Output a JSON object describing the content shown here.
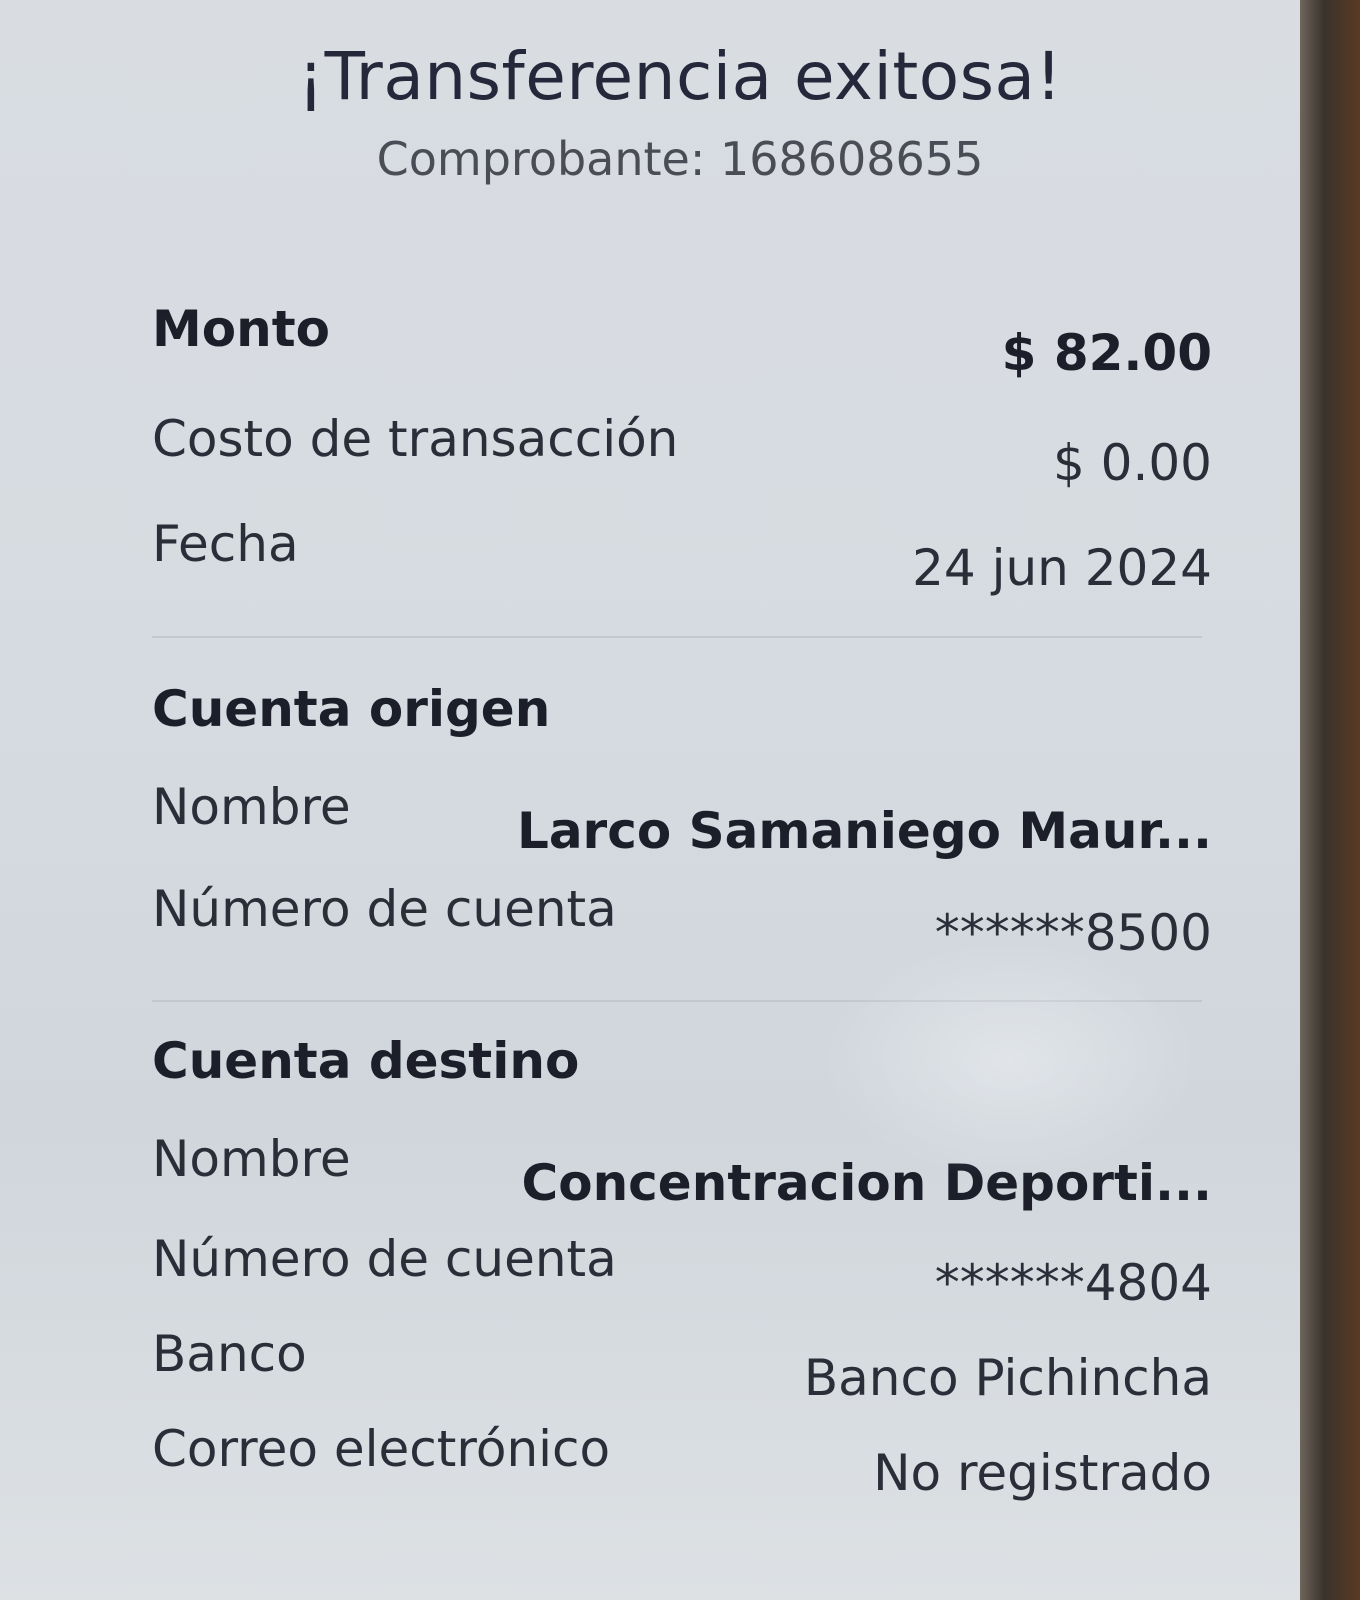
{
  "header": {
    "title": "¡Transferencia exitosa!",
    "receipt": "Comprobante: 168608655"
  },
  "summary": {
    "amount_label": "Monto",
    "amount_value": "$ 82.00",
    "fee_label": "Costo de transacción",
    "fee_value": "$ 0.00",
    "date_label": "Fecha",
    "date_value": "24 jun 2024"
  },
  "origin": {
    "title": "Cuenta origen",
    "name_label": "Nombre",
    "name_value": "Larco  Samaniego Maur...",
    "account_label": "Número de cuenta",
    "account_value": "******8500"
  },
  "destination": {
    "title": "Cuenta destino",
    "name_label": "Nombre",
    "name_value": "Concentracion Deporti...",
    "account_label": "Número de cuenta",
    "account_value": "******4804",
    "bank_label": "Banco",
    "bank_value": "Banco Pichincha",
    "email_label": "Correo electrónico",
    "email_value": "No registrado"
  }
}
